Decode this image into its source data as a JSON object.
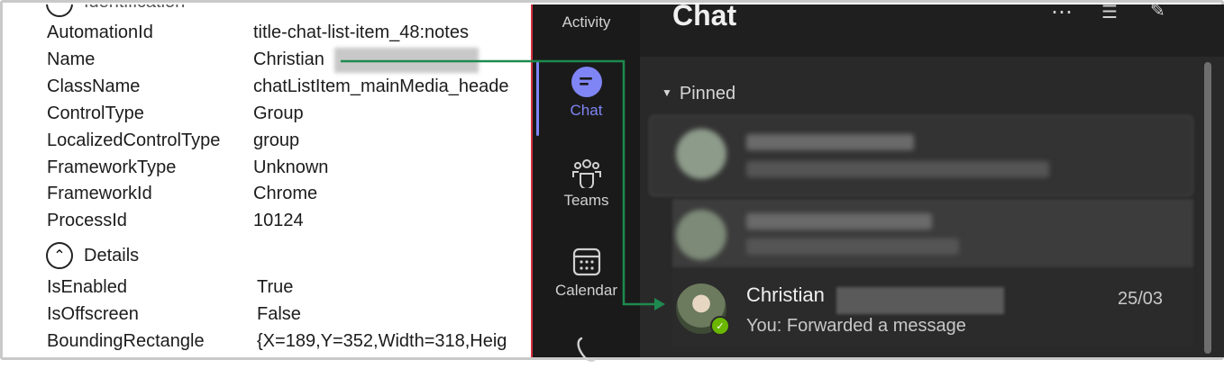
{
  "inspector": {
    "section_top_partial": "Identification",
    "properties": [
      {
        "label": "AutomationId",
        "value": "title-chat-list-item_48:notes"
      },
      {
        "label": "Name",
        "value": "Christian"
      },
      {
        "label": "ClassName",
        "value": "chatListItem_mainMedia_heade"
      },
      {
        "label": "ControlType",
        "value": "Group"
      },
      {
        "label": "LocalizedControlType",
        "value": "group"
      },
      {
        "label": "FrameworkType",
        "value": "Unknown"
      },
      {
        "label": "FrameworkId",
        "value": "Chrome"
      },
      {
        "label": "ProcessId",
        "value": "10124"
      }
    ],
    "details_title": "Details",
    "details": [
      {
        "label": "IsEnabled",
        "value": "True"
      },
      {
        "label": "IsOffscreen",
        "value": "False"
      },
      {
        "label": "BoundingRectangle",
        "value": "{X=189,Y=352,Width=318,Heig"
      }
    ]
  },
  "rail": {
    "items": [
      {
        "label": "Activity",
        "icon": "bell-icon"
      },
      {
        "label": "Chat",
        "icon": "chat-icon"
      },
      {
        "label": "Teams",
        "icon": "teams-icon"
      },
      {
        "label": "Calendar",
        "icon": "calendar-icon"
      },
      {
        "label": "",
        "icon": "phone-icon"
      }
    ],
    "active_color": "#7f85f5"
  },
  "chat_list": {
    "title": "Chat",
    "pinned_label": "Pinned",
    "selected": {
      "name": "Christian",
      "preview": "You: Forwarded a message",
      "time": "25/03",
      "presence": "available"
    }
  },
  "colors": {
    "arrow": "#1e8a4f",
    "presence_available": "#6bb700"
  }
}
